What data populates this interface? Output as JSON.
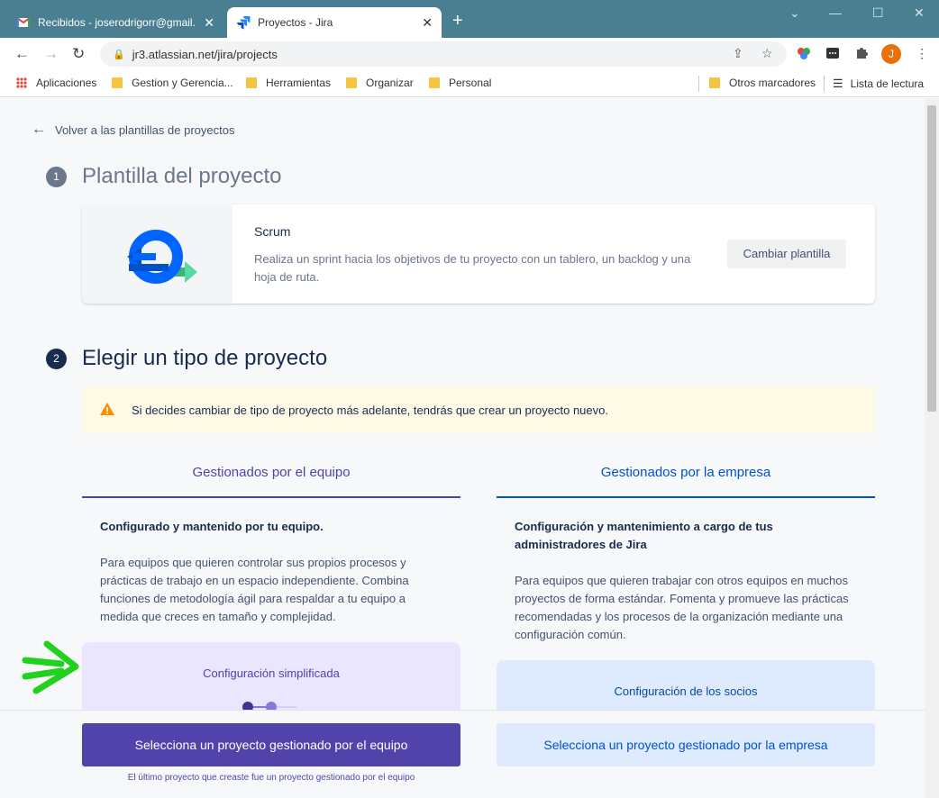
{
  "browser": {
    "tabs": [
      {
        "title": "Recibidos - joserodrigorr@gmail.",
        "active": false,
        "icon": "gmail-icon"
      },
      {
        "title": "Proyectos - Jira",
        "active": true,
        "icon": "jira-icon"
      }
    ],
    "url": "jr3.atlassian.net/jira/projects",
    "profile_initial": "J",
    "bookmarks": [
      "Aplicaciones",
      "Gestion y Gerencia...",
      "Herramientas",
      "Organizar",
      "Personal"
    ],
    "bookmarks_right": [
      "Otros marcadores",
      "Lista de lectura"
    ]
  },
  "page": {
    "back_link": "Volver a las plantillas de proyectos",
    "step1": {
      "number": "1",
      "title": "Plantilla del proyecto"
    },
    "template": {
      "name": "Scrum",
      "description": "Realiza un sprint hacia los objetivos de tu proyecto con un tablero, un backlog y una hoja de ruta.",
      "change_button": "Cambiar plantilla"
    },
    "step2": {
      "number": "2",
      "title": "Elegir un tipo de proyecto"
    },
    "warning": "Si decides cambiar de tipo de proyecto más adelante, tendrás que crear un proyecto nuevo.",
    "team_managed": {
      "tab": "Gestionados por el equipo",
      "heading": "Configurado y mantenido por tu equipo.",
      "description": "Para equipos que quieren controlar sus propios procesos y prácticas de trabajo en un espacio independiente. Combina funciones de metodología ágil para respaldar a tu equipo a medida que creces en tamaño y complejidad.",
      "config_label": "Configuración simplificada",
      "select_button": "Selecciona un proyecto gestionado por el equipo",
      "last_note": "El último proyecto que creaste fue un proyecto gestionado por el equipo"
    },
    "company_managed": {
      "tab": "Gestionados por la empresa",
      "heading": "Configuración y mantenimiento a cargo de tus administradores de Jira",
      "description": "Para equipos que quieren trabajar con otros equipos en muchos proyectos de forma estándar. Fomenta y promueve las prácticas recomendadas y los procesos de la organización mediante una configuración común.",
      "config_label": "Configuración de los socios",
      "select_button": "Selecciona un proyecto gestionado por la empresa"
    }
  },
  "colors": {
    "tabbar": "#4a7e91",
    "team_purple": "#5243aa",
    "company_blue": "#0052cc",
    "warning_bg": "#fffae6",
    "annotation_green": "#22d11e"
  }
}
